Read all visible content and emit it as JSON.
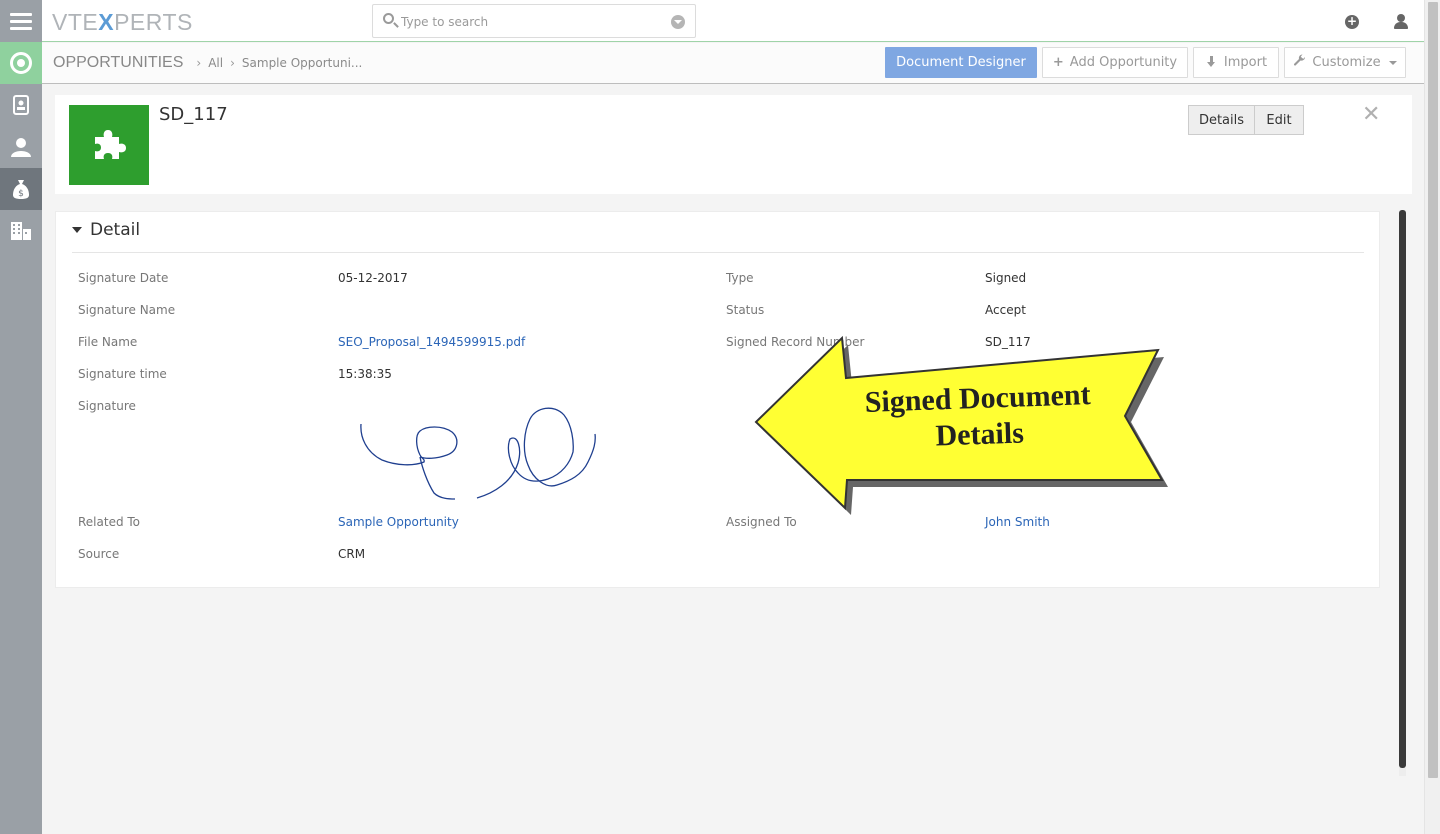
{
  "app": {
    "logo_prefix": "VTE",
    "logo_accent": "X",
    "logo_suffix": "PERTS"
  },
  "search": {
    "placeholder": "Type to search"
  },
  "breadcrumb": {
    "module": "OPPORTUNITIES",
    "filter": "All",
    "record": "Sample Opportuni..."
  },
  "toolbar": {
    "document_designer": "Document Designer",
    "add_opportunity": "Add Opportunity",
    "import": "Import",
    "customize": "Customize"
  },
  "record": {
    "title": "SD_117",
    "details_btn": "Details",
    "edit_btn": "Edit"
  },
  "detail": {
    "section_title": "Detail",
    "left_fields": [
      {
        "label": "Signature Date",
        "value": "05-12-2017"
      },
      {
        "label": "Signature Name",
        "value": ""
      },
      {
        "label": "File Name",
        "value": "SEO_Proposal_1494599915.pdf"
      },
      {
        "label": "Signature time",
        "value": "15:38:35"
      },
      {
        "label": "Signature",
        "value": ""
      },
      {
        "label": "Related To",
        "value": "Sample Opportunity"
      },
      {
        "label": "Source",
        "value": "CRM"
      }
    ],
    "right_fields": [
      {
        "label": "Type",
        "value": "Signed"
      },
      {
        "label": "Status",
        "value": "Accept"
      },
      {
        "label": "Signed Record Number",
        "value": "SD_117"
      },
      {
        "label": "Assigned To",
        "value": "John Smith"
      }
    ]
  },
  "callout": {
    "line1": "Signed Document",
    "line2": "Details"
  },
  "colors": {
    "sidebar": "#9aa0a6",
    "sidebar_home": "#8fd19e",
    "primary_button": "#7fa7e2",
    "record_icon": "#2e9e2e",
    "link": "#2b65b7",
    "callout_fill": "#ffff33"
  },
  "icons": {
    "sidebar": [
      "menu-icon",
      "home-icon",
      "contacts-icon",
      "user-icon",
      "money-bag-icon",
      "organization-icon"
    ],
    "record": "puzzle-icon"
  }
}
